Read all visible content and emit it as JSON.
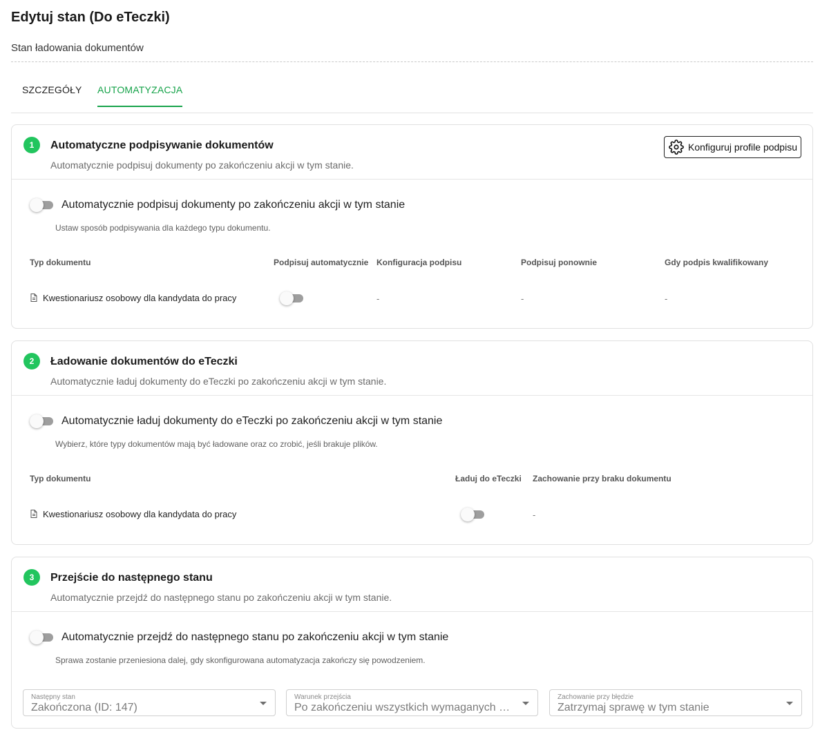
{
  "header": {
    "title": "Edytuj stan (Do eTeczki)",
    "subtitle": "Stan ładowania dokumentów"
  },
  "tabs": [
    {
      "label": "SZCZEGÓŁY",
      "active": false
    },
    {
      "label": "AUTOMATYZACJA",
      "active": true
    }
  ],
  "colors": {
    "accent": "#16a34a",
    "badge": "#22c55e",
    "toggle_off": "#9e9e9e"
  },
  "sections": [
    {
      "number": "1",
      "title": "Automatyczne podpisywanie dokumentów",
      "description": "Automatycznie podpisuj dokumenty po zakończeniu akcji w tym stanie.",
      "config_button": "Konfiguruj profile podpisu",
      "toggle_label": "Automatycznie podpisuj dokumenty po zakończeniu akcji w tym stanie",
      "toggle_on": false,
      "helper": "Ustaw sposób podpisywania dla każdego typu dokumentu.",
      "columns": [
        "Typ dokumentu",
        "Podpisuj automatycznie",
        "Konfiguracja podpisu",
        "Podpisuj ponownie",
        "Gdy podpis kwalifikowany"
      ],
      "rows": [
        {
          "document": "Kwestionariusz osobowy dla kandydata do pracy",
          "auto": false,
          "config": "-",
          "resign": "-",
          "qualified": "-"
        }
      ]
    },
    {
      "number": "2",
      "title": "Ładowanie dokumentów do eTeczki",
      "description": "Automatycznie ładuj dokumenty do eTeczki po zakończeniu akcji w tym stanie.",
      "toggle_label": "Automatycznie ładuj dokumenty do eTeczki po zakończeniu akcji w tym stanie",
      "toggle_on": false,
      "helper": "Wybierz, które typy dokumentów mają być ładowane oraz co zrobić, jeśli brakuje plików.",
      "columns": [
        "Typ dokumentu",
        "Ładuj do eTeczki",
        "Zachowanie przy braku dokumentu"
      ],
      "rows": [
        {
          "document": "Kwestionariusz osobowy dla kandydata do pracy",
          "load": false,
          "missing": "-"
        }
      ]
    },
    {
      "number": "3",
      "title": "Przejście do następnego stanu",
      "description": "Automatycznie przejdź do następnego stanu po zakończeniu akcji w tym stanie.",
      "toggle_label": "Automatycznie przejdź do następnego stanu po zakończeniu akcji w tym stanie",
      "toggle_on": false,
      "helper": "Sprawa zostanie przeniesiona dalej, gdy skonfigurowana automatyzacja zakończy się powodzeniem.",
      "fields": [
        {
          "label": "Następny stan",
          "value": "Zakończona (ID: 147)"
        },
        {
          "label": "Warunek przejścia",
          "value": "Po zakończeniu wszystkich wymaganych akcji"
        },
        {
          "label": "Zachowanie przy błędzie",
          "value": "Zatrzymaj sprawę w tym stanie"
        }
      ]
    }
  ]
}
